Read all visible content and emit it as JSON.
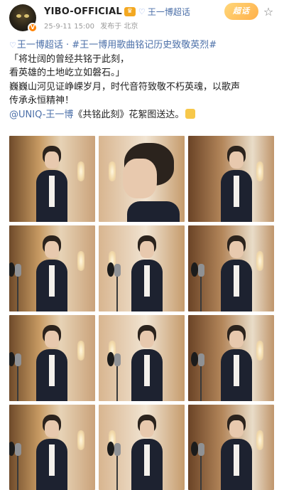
{
  "post": {
    "username": "YIBO-OFFICIAL",
    "crown_glyph": "♛",
    "supertopic_icon": "♡",
    "supertopic_link": "王一博超话",
    "time": "25-9-11 15:00",
    "posted_from": "发布于 北京",
    "badge": "超话",
    "star_glyph": "☆",
    "verify_glyph": "V"
  },
  "content": {
    "line1": {
      "tag_icon": "♡",
      "topic": "王一博超话",
      "sep": " · ",
      "hashtag": "#王一博用歌曲铭记历史致敬英烈#"
    },
    "line2": "「将壮阔的曾经共铭于此刻，",
    "line3": "看英雄的土地屹立如磐石。」",
    "line4": "巍巍山河见证峥嵘岁月，时代音符致敬不朽英魂，以歌声",
    "line5": "传承永恒精神！",
    "line6": {
      "mention": "@UNIQ-王一博",
      "text": "《共铭此刻》花絮图送达。"
    }
  },
  "gallery": {
    "count": 12
  },
  "colors": {
    "link": "#4b6fa8",
    "badge": "#ffb04a",
    "verify": "#ff8200"
  }
}
